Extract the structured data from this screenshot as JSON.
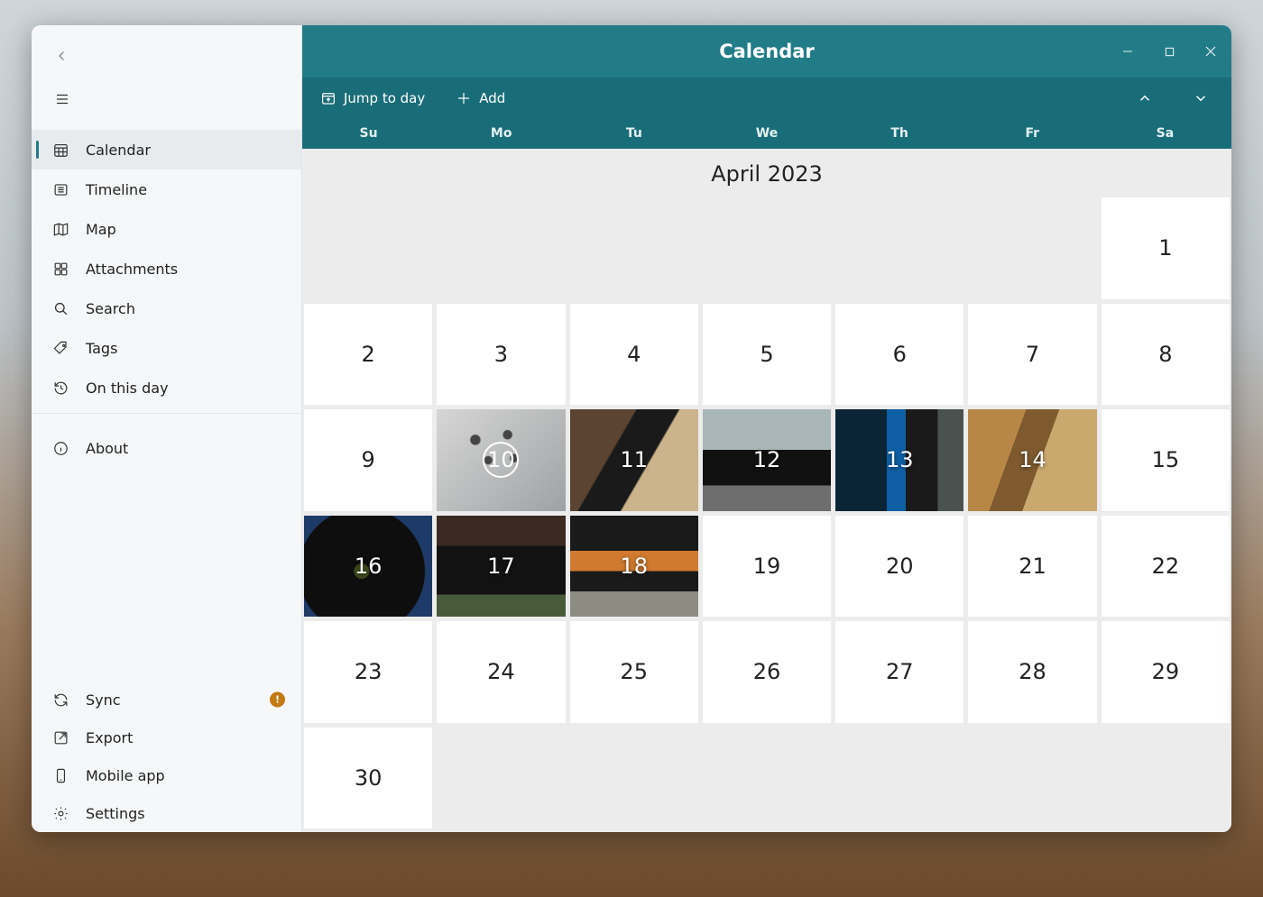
{
  "window": {
    "title": "Calendar"
  },
  "sidebar": {
    "items": [
      {
        "label": "Calendar",
        "icon": "calendar-grid-icon",
        "active": true
      },
      {
        "label": "Timeline",
        "icon": "timeline-icon",
        "active": false
      },
      {
        "label": "Map",
        "icon": "map-icon",
        "active": false
      },
      {
        "label": "Attachments",
        "icon": "attachment-icon",
        "active": false
      },
      {
        "label": "Search",
        "icon": "search-icon",
        "active": false
      },
      {
        "label": "Tags",
        "icon": "tag-icon",
        "active": false
      },
      {
        "label": "On this day",
        "icon": "history-icon",
        "active": false
      },
      {
        "label": "About",
        "icon": "info-icon",
        "active": false
      }
    ],
    "bottom": [
      {
        "label": "Sync",
        "icon": "sync-icon",
        "badge": "!"
      },
      {
        "label": "Export",
        "icon": "export-icon"
      },
      {
        "label": "Mobile app",
        "icon": "phone-icon"
      },
      {
        "label": "Settings",
        "icon": "gear-icon"
      }
    ]
  },
  "toolbar": {
    "jump_label": "Jump to day",
    "add_label": "Add"
  },
  "calendar": {
    "month_label": "April 2023",
    "day_headers": [
      "Su",
      "Mo",
      "Tu",
      "We",
      "Th",
      "Fr",
      "Sa"
    ],
    "leading_blanks": 6,
    "days_in_month": 30,
    "selected_day": 10,
    "days_with_photos": [
      10,
      11,
      12,
      13,
      14,
      16,
      17,
      18
    ],
    "thumb_class": {
      "10": "t10",
      "11": "t11",
      "12": "t12",
      "13": "t13",
      "14": "t14",
      "16": "t16",
      "17": "t17",
      "18": "t18"
    }
  },
  "colors": {
    "accent": "#227c87",
    "accent_dark": "#196d78"
  }
}
